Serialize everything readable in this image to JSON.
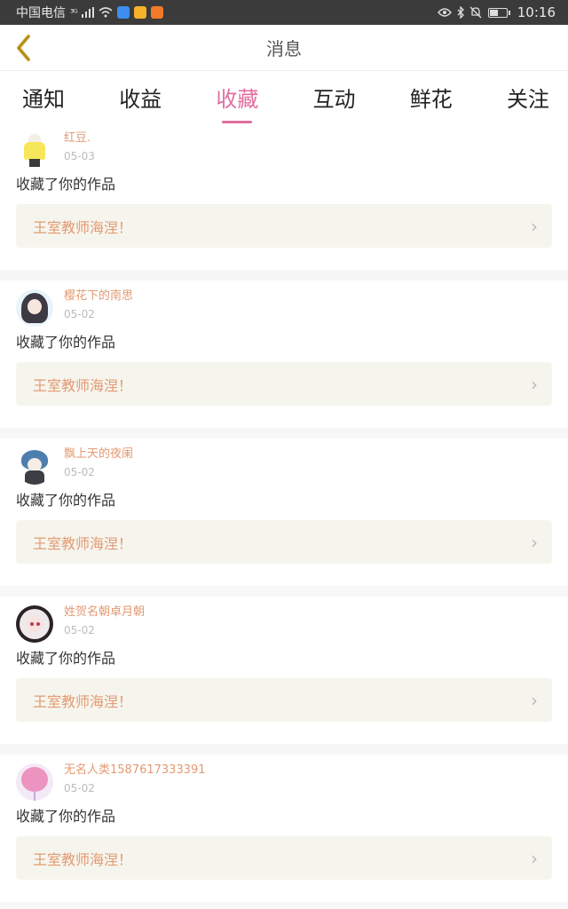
{
  "status_bar": {
    "carrier": "中国电信",
    "network": "³ᴳ",
    "time": "10:16",
    "battery_level": 0.45
  },
  "header": {
    "title": "消息",
    "back_icon": "chevron-left-icon",
    "accent_color": "#c9a227"
  },
  "tabs": [
    {
      "label": "通知",
      "active": false
    },
    {
      "label": "收益",
      "active": false
    },
    {
      "label": "收藏",
      "active": true
    },
    {
      "label": "互动",
      "active": false
    },
    {
      "label": "鲜花",
      "active": false
    },
    {
      "label": "关注",
      "active": false
    }
  ],
  "colors": {
    "active_tab": "#e06ea1",
    "username": "#e39a72",
    "work_title": "#e39a72",
    "work_bg": "#f5f5ee"
  },
  "items": [
    {
      "username": "红豆.",
      "date": "05-03",
      "action": "收藏了你的作品",
      "work_title": "王室教师海涅！"
    },
    {
      "username": "樱花下的南思",
      "date": "05-02",
      "action": "收藏了你的作品",
      "work_title": "王室教师海涅！"
    },
    {
      "username": "飘上天的夜阑",
      "date": "05-02",
      "action": "收藏了你的作品",
      "work_title": "王室教师海涅！"
    },
    {
      "username": "姓贺名朝卓月朝",
      "date": "05-02",
      "action": "收藏了你的作品",
      "work_title": "王室教师海涅！"
    },
    {
      "username": "无名人类1587617333391",
      "date": "05-02",
      "action": "收藏了你的作品",
      "work_title": "王室教师海涅！"
    }
  ]
}
